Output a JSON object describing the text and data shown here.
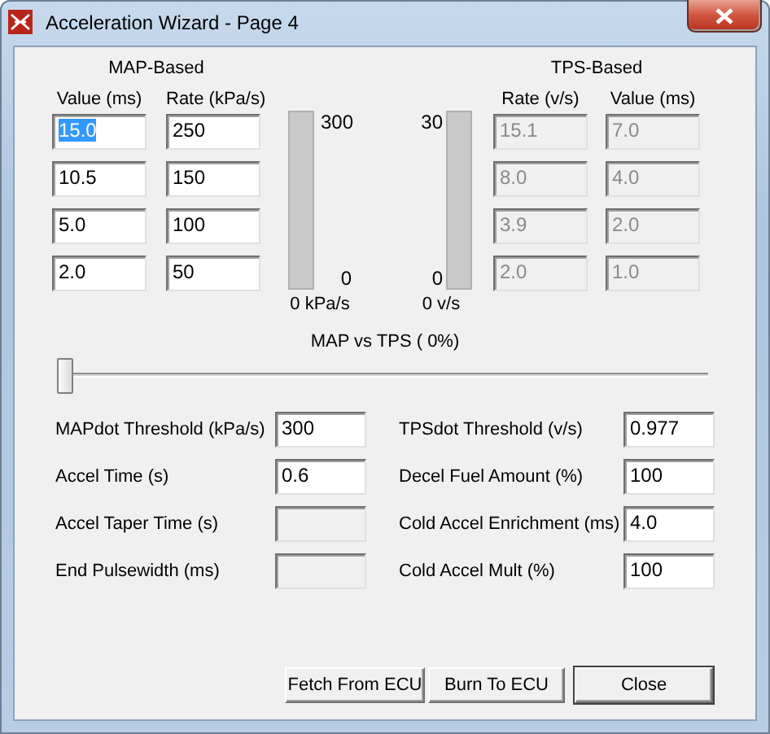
{
  "window": {
    "title": "Acceleration Wizard - Page 4"
  },
  "map_based": {
    "title": "MAP-Based",
    "columns": [
      "Value (ms)",
      "Rate (kPa/s)"
    ],
    "disabled": false,
    "rows": [
      {
        "cells": [
          "15.0",
          "250"
        ],
        "highlighted": true
      },
      {
        "cells": [
          "10.5",
          "150"
        ],
        "highlighted": false
      },
      {
        "cells": [
          "5.0",
          "100"
        ],
        "highlighted": false
      },
      {
        "cells": [
          "2.0",
          "50"
        ],
        "highlighted": false
      }
    ]
  },
  "map_gauge": {
    "max": "300",
    "min": "0",
    "reading": "0 kPa/s"
  },
  "tps_gauge": {
    "max": "30",
    "min": "0",
    "reading": "0 v/s"
  },
  "tps_based": {
    "title": "TPS-Based",
    "columns": [
      "Rate (v/s)",
      "Value (ms)"
    ],
    "disabled": true,
    "rows": [
      {
        "cells": [
          "15.1",
          "7.0"
        ],
        "highlighted": false
      },
      {
        "cells": [
          "8.0",
          "4.0"
        ],
        "highlighted": false
      },
      {
        "cells": [
          "3.9",
          "2.0"
        ],
        "highlighted": false
      },
      {
        "cells": [
          "2.0",
          "1.0"
        ],
        "highlighted": false
      }
    ]
  },
  "blend": {
    "label": "MAP vs TPS (  0%)",
    "level": 0
  },
  "settings_left": [
    {
      "label": "MAPdot Threshold (kPa/s)",
      "value": "300",
      "disabled": false
    },
    {
      "label": "Accel Time (s)",
      "value": "0.6",
      "disabled": false
    },
    {
      "label": "Accel Taper Time (s)",
      "disabled": true
    },
    {
      "label": "End Pulsewidth (ms)",
      "disabled": true
    }
  ],
  "settings_right": [
    {
      "label": "TPSdot Threshold (v/s)",
      "value": "0.977",
      "disabled": false
    },
    {
      "label": "Decel Fuel Amount (%)",
      "value": "100",
      "disabled": false
    },
    {
      "label": "Cold Accel Enrichment (ms)",
      "value": "4.0",
      "disabled": false
    },
    {
      "label": "Cold Accel Mult (%)",
      "value": "100",
      "disabled": false
    }
  ],
  "buttons": [
    {
      "label": "Fetch From ECU",
      "default": false
    },
    {
      "label": "Burn To ECU",
      "default": false
    },
    {
      "label": "Close",
      "default": true
    }
  ]
}
